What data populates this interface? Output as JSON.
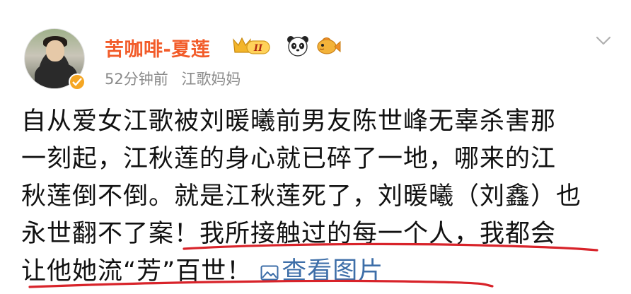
{
  "post": {
    "author": "苦咖啡-夏莲",
    "time": "52分钟前",
    "source": "江歌妈妈",
    "lines": [
      "自从爱女江歌被刘暖曦前男友陈世峰无辜杀害那",
      "一刻起，江秋莲的身心就已碎了一地，哪来的江",
      "秋莲倒不倒。就是江秋莲死了，刘暖曦（刘鑫）也",
      "永世翻不了案！我所接触过的每一个人，我都会",
      "让他她流“芳”百世！"
    ],
    "view_images_label": "查看图片"
  },
  "badges": {
    "level_label": "II"
  },
  "colors": {
    "username": "#f25c2a",
    "link": "#3d6ea8",
    "annotation_underline": "#d8232a",
    "verified": "#f5a623"
  },
  "icons": [
    "verified-icon",
    "crown-badge-icon",
    "panda-icon",
    "fish-icon",
    "chevron-down-icon",
    "image-icon"
  ]
}
